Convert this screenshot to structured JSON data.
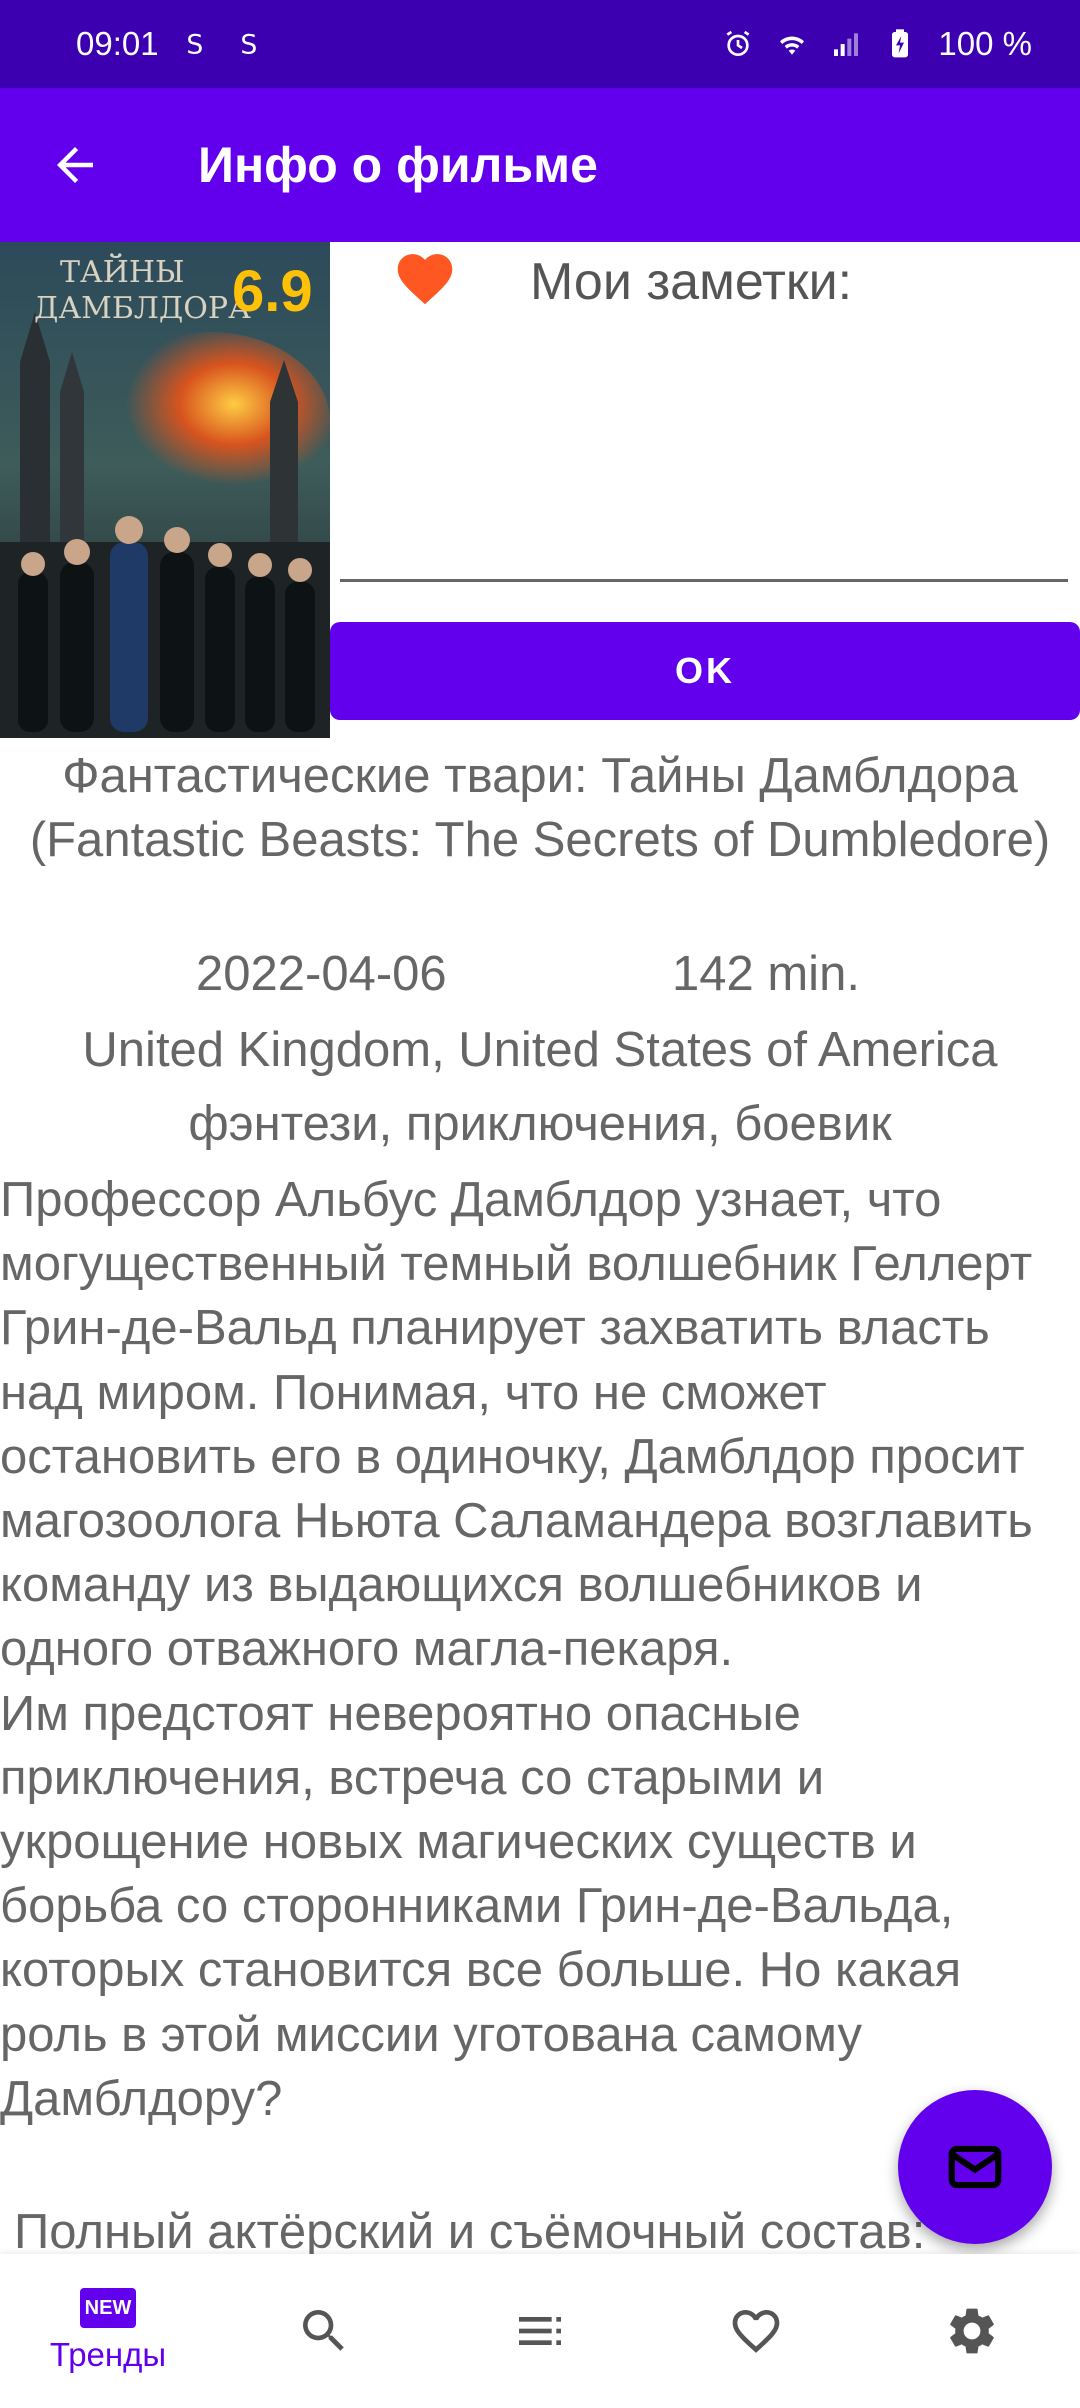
{
  "status_bar": {
    "time": "09:01",
    "left_icons": [
      "s-icon",
      "s-icon"
    ],
    "battery": "100 %"
  },
  "app_bar": {
    "title": "Инфо о фильме"
  },
  "movie": {
    "rating": "6.9",
    "notes_label": "Мои заметки:",
    "notes_value": "",
    "ok_label": "OK",
    "title": "Фантастические твари: Тайны Дамблдора (Fantastic Beasts: The Secrets of Dumbledore)",
    "release_date": "2022-04-06",
    "duration": "142 min.",
    "countries": "United Kingdom, United States of America",
    "genres": "фэнтези, приключения, боевик",
    "overview": "Профессор Альбус Дамблдор узнает, что могущественный темный волшебник Геллерт Грин-де-Вальд планирует захватить власть над миром. Понимая, что не сможет остановить его в одиночку, Дамблдор просит магозоолога Ньюта Саламандера возглавить команду из выдающихся волшебников и одного отважного магла-пекаря.\nИм предстоят невероятно опасные приключения, встреча со старыми и укрощение новых магических существ и борьба со сторонниками Грин-де-Вальда, которых становится все больше. Но какая роль в этой миссии уготована самому Дамблдору?",
    "cast_heading": "Полный актёрский и съёмочный состав:"
  },
  "bottom_nav": {
    "items": [
      {
        "label": "Тренды",
        "icon": "new-badge-icon",
        "active": true,
        "badge": "NEW"
      },
      {
        "label": "",
        "icon": "search-icon",
        "active": false
      },
      {
        "label": "",
        "icon": "list-icon",
        "active": false
      },
      {
        "label": "",
        "icon": "heart-outline-icon",
        "active": false
      },
      {
        "label": "",
        "icon": "gear-icon",
        "active": false
      }
    ]
  },
  "colors": {
    "status_bar": "#3D00B0",
    "primary": "#6200EE",
    "rating": "#FFC107",
    "favorite": "#FF5722"
  }
}
